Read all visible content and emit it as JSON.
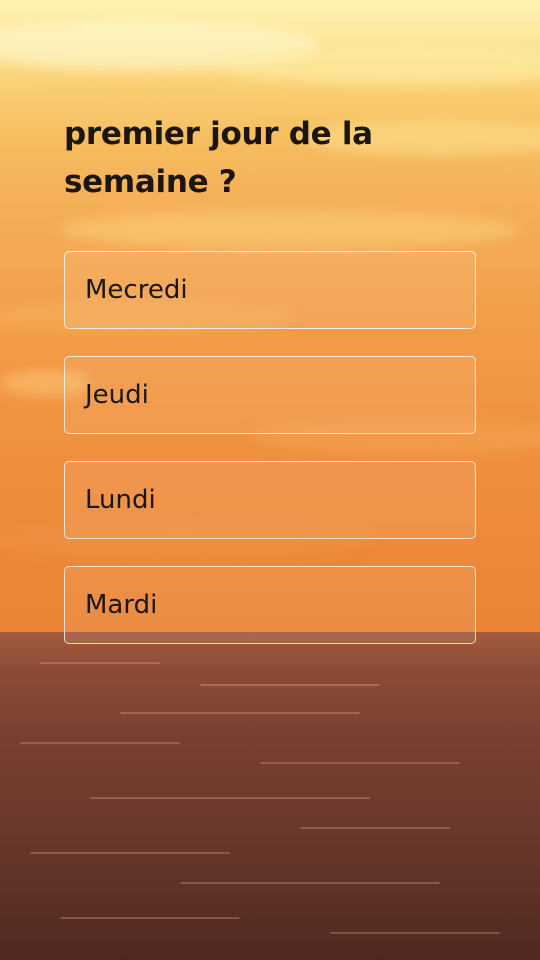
{
  "question": {
    "text": "premier jour de la semaine ?"
  },
  "options": [
    {
      "label": "Mecredi"
    },
    {
      "label": "Jeudi"
    },
    {
      "label": "Lundi"
    },
    {
      "label": "Mardi"
    }
  ],
  "colors": {
    "sky_top": "#fff2b3",
    "sky_bottom": "#eb8335",
    "sea_top": "#a45b3e",
    "sea_bottom": "#4f2820",
    "text": "#1c1510",
    "option_border": "#ffffff"
  }
}
